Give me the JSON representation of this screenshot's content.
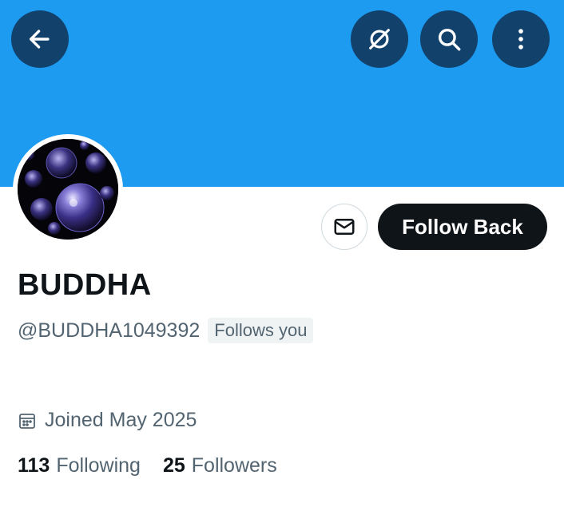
{
  "header": {
    "banner_color": "#1d9bf0",
    "buttons": [
      {
        "icon": "back-arrow-icon"
      },
      {
        "icon": "grok-icon"
      },
      {
        "icon": "search-icon"
      },
      {
        "icon": "more-vertical-icon"
      }
    ]
  },
  "profile": {
    "avatar_description": "purple bubbles on black",
    "display_name": "BUDDHA",
    "handle": "@BUDDHA1049392",
    "follows_you_badge": "Follows you",
    "joined": "Joined May 2025",
    "following_count": "113",
    "following_label": "Following",
    "followers_count": "25",
    "followers_label": "Followers"
  },
  "actions": {
    "message_icon": "mail-icon",
    "follow_label": "Follow Back"
  },
  "colors": {
    "primary_text": "#0f1419",
    "secondary_text": "#536471",
    "follow_button": "#0f1419"
  }
}
